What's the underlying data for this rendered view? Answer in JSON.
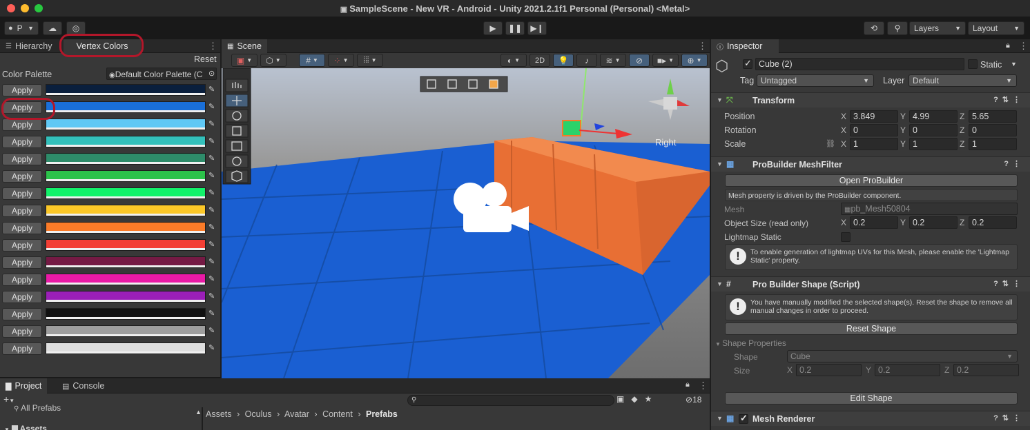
{
  "window": {
    "title": "SampleScene - New VR - Android - Unity 2021.2.1f1 Personal (Personal) <Metal>"
  },
  "toolbar": {
    "account_label": "P",
    "layers_label": "Layers",
    "layout_label": "Layout"
  },
  "left_panel": {
    "tabs": [
      {
        "label": "Hierarchy"
      },
      {
        "label": "Vertex Colors"
      }
    ],
    "reset_label": "Reset",
    "palette_label": "Color Palette",
    "palette_value": "Default Color Palette (C",
    "apply_label": "Apply",
    "colors": [
      "#0a1f3d",
      "#1a6fd8",
      "#5fc8f5",
      "#33c0bb",
      "#2e8c6a",
      "#2cc24a",
      "#12f26a",
      "#fbc728",
      "#fb7b28",
      "#f33f35",
      "#751a44",
      "#ea1aa6",
      "#9b1fb8",
      "#111111",
      "#9e9e9e",
      "#dedede"
    ]
  },
  "scene": {
    "tab_label": "Scene",
    "btn_2d": "2D",
    "gizmo_label": "Right"
  },
  "project_panel": {
    "tabs": [
      {
        "label": "Project"
      },
      {
        "label": "Console"
      }
    ],
    "tree": [
      {
        "label": "All Prefabs"
      },
      {
        "label": "Assets"
      }
    ],
    "breadcrumb": [
      "Assets",
      "Oculus",
      "Avatar",
      "Content",
      "Prefabs"
    ],
    "hidden_count": "18"
  },
  "inspector": {
    "tab_label": "Inspector",
    "object_name": "Cube (2)",
    "static_label": "Static",
    "tag_label": "Tag",
    "tag_value": "Untagged",
    "layer_label": "Layer",
    "layer_value": "Default",
    "transform": {
      "title": "Transform",
      "position_label": "Position",
      "rotation_label": "Rotation",
      "scale_label": "Scale",
      "position": {
        "x": "3.849",
        "y": "4.99",
        "z": "5.65"
      },
      "rotation": {
        "x": "0",
        "y": "0",
        "z": "0"
      },
      "scale": {
        "x": "1",
        "y": "1",
        "z": "1"
      }
    },
    "mesh_filter": {
      "title": "ProBuilder MeshFilter",
      "open_btn": "Open ProBuilder",
      "driven_note": "Mesh property is driven by the ProBuilder component.",
      "mesh_label": "Mesh",
      "mesh_value": "pb_Mesh50804",
      "size_label": "Object Size (read only)",
      "size": {
        "x": "0.2",
        "y": "0.2",
        "z": "0.2"
      },
      "lightmap_label": "Lightmap Static",
      "lightmap_help": "To enable generation of lightmap UVs for this Mesh, please enable the 'Lightmap Static' property."
    },
    "shape_script": {
      "title": "Pro Builder Shape (Script)",
      "help": "You have manually modified the selected shape(s). Reset the shape to remove all manual changes in order to proceed.",
      "reset_btn": "Reset Shape",
      "props_label": "Shape Properties",
      "shape_label": "Shape",
      "shape_value": "Cube",
      "size_label": "Size",
      "size": {
        "x": "0.2",
        "y": "0.2",
        "z": "0.2"
      },
      "edit_btn": "Edit Shape"
    },
    "mesh_renderer": {
      "title": "Mesh Renderer"
    }
  },
  "axes": {
    "x": "X",
    "y": "Y",
    "z": "Z"
  }
}
